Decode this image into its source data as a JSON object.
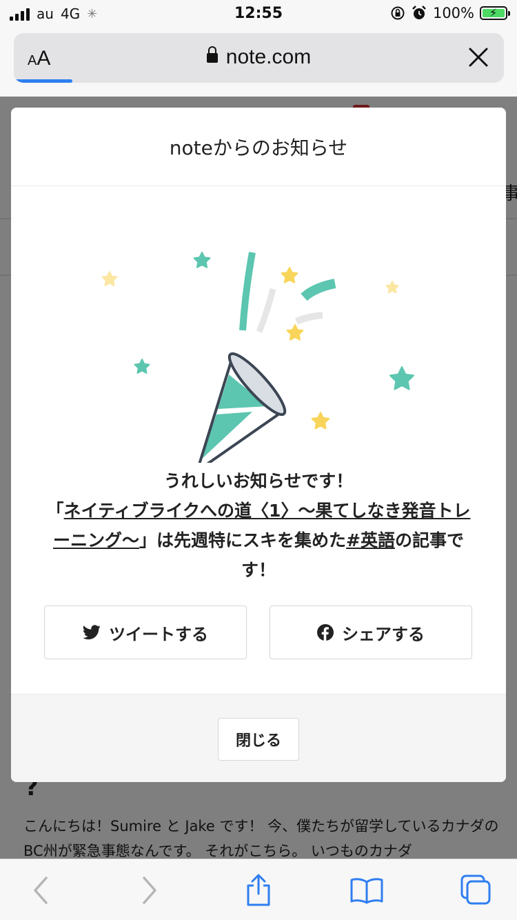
{
  "status_bar": {
    "carrier": "au",
    "network": "4G",
    "time": "12:55",
    "battery_percent": "100%",
    "battery_level": 1.0
  },
  "browser": {
    "text_size_small": "A",
    "text_size_big": "A",
    "url": "note.com",
    "load_progress": 0.12
  },
  "page": {
    "partial_heading_char": "事",
    "partial_heading_line": "?",
    "body_text": "こんにちは！Sumire と Jake です！ 今、僕たちが留学しているカナダのBC州が緊急事態なんです。 それがこちら。 いつものカナダ"
  },
  "modal": {
    "title": "noteからのお知らせ",
    "message_line1": "うれしいお知らせです！",
    "quote_open": "「",
    "article_title": "ネイティブライクへの道〈1〉〜果てしなき発音トレーニング〜",
    "quote_close_and_text": "」は先週特にスキを集めた",
    "hashtag_prefix": "#",
    "hashtag": "英語",
    "message_suffix": "の記事です！",
    "tweet_label": "ツイートする",
    "share_label": "シェアする",
    "close_label": "閉じる"
  },
  "colors": {
    "teal": "#5cc6b0",
    "star_yellow": "#f8d55a",
    "star_pale": "#fbe7a2",
    "gray_streamer": "#e6e6e6",
    "outline": "#3c4654",
    "ios_blue": "#2f7ef0"
  },
  "icons": {
    "tweet": "twitter-bird-icon",
    "share": "facebook-icon",
    "back": "chevron-left-icon",
    "forward": "chevron-right-icon",
    "share_sheet": "share-icon",
    "bookmarks": "book-icon",
    "tabs": "tabs-icon"
  }
}
